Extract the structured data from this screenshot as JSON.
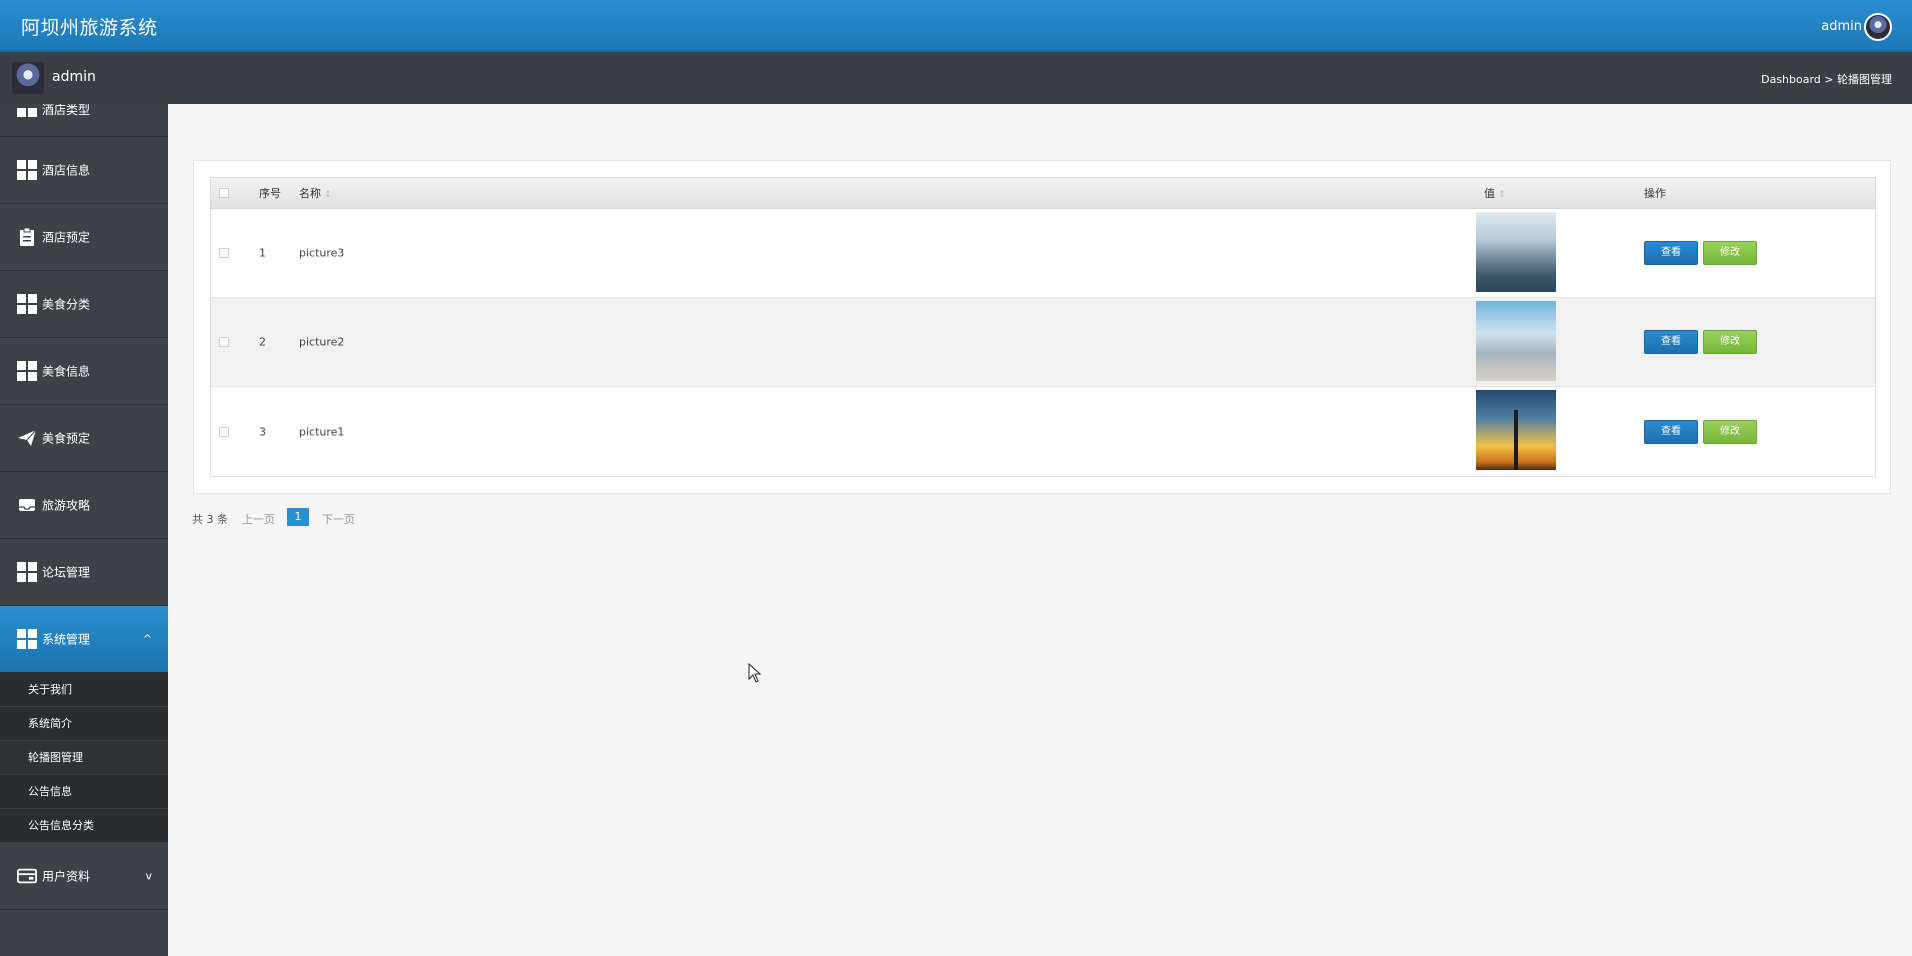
{
  "app": {
    "title": "阿坝州旅游系统",
    "user": "admin"
  },
  "subbar": {
    "username": "admin",
    "breadcrumb": "Dashboard > 轮播图管理"
  },
  "sidebar": {
    "partial_item": "酒店类型",
    "items": [
      {
        "label": "酒店信息",
        "icon": "grid-icon"
      },
      {
        "label": "酒店预定",
        "icon": "clipboard-icon"
      },
      {
        "label": "美食分类",
        "icon": "grid-icon"
      },
      {
        "label": "美食信息",
        "icon": "grid-icon"
      },
      {
        "label": "美食预定",
        "icon": "paper-plane-icon"
      },
      {
        "label": "旅游攻略",
        "icon": "inbox-icon"
      },
      {
        "label": "论坛管理",
        "icon": "grid-icon"
      }
    ],
    "active_item": {
      "label": "系统管理",
      "icon": "grid-icon",
      "caret": "^"
    },
    "sub_items": [
      "关于我们",
      "系统简介",
      "轮播图管理",
      "公告信息",
      "公告信息分类"
    ],
    "last_item": {
      "label": "用户资料",
      "icon": "card-icon",
      "caret": "v"
    }
  },
  "table": {
    "headers": {
      "index": "序号",
      "name": "名称",
      "value": "值",
      "actions": "操作"
    },
    "rows": [
      {
        "index": "1",
        "name": "picture3",
        "view": "查看",
        "edit": "修改"
      },
      {
        "index": "2",
        "name": "picture2",
        "view": "查看",
        "edit": "修改"
      },
      {
        "index": "3",
        "name": "picture1",
        "view": "查看",
        "edit": "修改"
      }
    ]
  },
  "pagination": {
    "total": "共 3 条",
    "prev": "上一页",
    "current": "1",
    "next": "下一页"
  },
  "colors": {
    "accent": "#2a8fd0",
    "sidebar": "#3d4246",
    "edit": "#8cc54d"
  }
}
